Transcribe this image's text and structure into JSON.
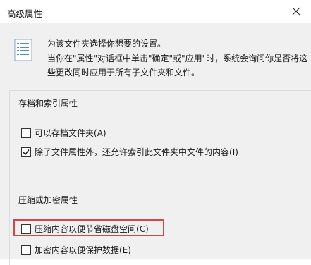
{
  "window": {
    "title": "高级属性",
    "close_label": "×"
  },
  "header": {
    "icon": "document-properties-icon",
    "line1": "为该文件夹选择你想要的设置。",
    "line2": "当你在\"属性\"对话框中单击\"确定\"或\"应用\"时，系统会询问你是否将这",
    "line3": "些更改同时应用于所有子文件夹和文件。"
  },
  "archive_group": {
    "title": "存档和索引属性",
    "options": [
      {
        "text": "可以存档文件夹(",
        "key": "A",
        "suffix": ")",
        "checked": false
      },
      {
        "text": "除了文件属性外，还允许索引此文件夹中文件的内容(",
        "key": "I",
        "suffix": ")",
        "checked": true
      }
    ]
  },
  "compress_group": {
    "title": "压缩或加密属性",
    "options": [
      {
        "text": "压缩内容以便节省磁盘空间(",
        "key": "C",
        "suffix": ")",
        "checked": false
      },
      {
        "text": "加密内容以便保护数据(",
        "key": "E",
        "suffix": ")",
        "checked": false
      }
    ]
  },
  "colors": {
    "highlight_border": "#d64547",
    "dialog_background": "#f0f0f0"
  }
}
